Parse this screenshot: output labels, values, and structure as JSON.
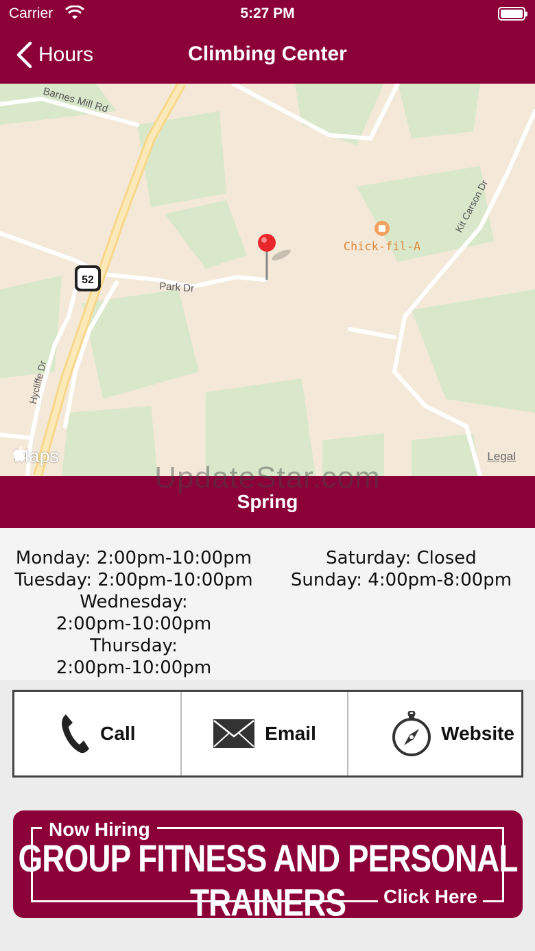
{
  "status_bar": {
    "carrier": "Carrier",
    "time": "5:27 PM"
  },
  "nav": {
    "back_label": "Hours",
    "title": "Climbing Center"
  },
  "map": {
    "labels": {
      "barnes": "Barnes Mill Rd",
      "park": "Park Dr",
      "kit_carson": "Kit Carson Dr",
      "hycliffe": "Hycliffe Dr",
      "chickfila": "Chick-fil-A",
      "route": "52"
    },
    "maps_logo": "Maps",
    "legal": "Legal"
  },
  "watermark": "UpdateStar.com",
  "season": "Spring",
  "hours": {
    "left": [
      "Monday: 2:00pm-10:00pm",
      "Tuesday: 2:00pm-10:00pm",
      "Wednesday:",
      "2:00pm-10:00pm",
      "Thursday:",
      "2:00pm-10:00pm"
    ],
    "right": [
      "Saturday: Closed",
      "Sunday: 4:00pm-8:00pm"
    ]
  },
  "contact": {
    "call": "Call",
    "email": "Email",
    "website": "Website"
  },
  "banner": {
    "top": "Now Hiring",
    "main": "GROUP FITNESS AND PERSONAL TRAINERS",
    "cta": "Click Here"
  },
  "colors": {
    "brand": "#8b0038",
    "map_bg": "#f4e9d9",
    "park_green": "#d8e8cc"
  }
}
